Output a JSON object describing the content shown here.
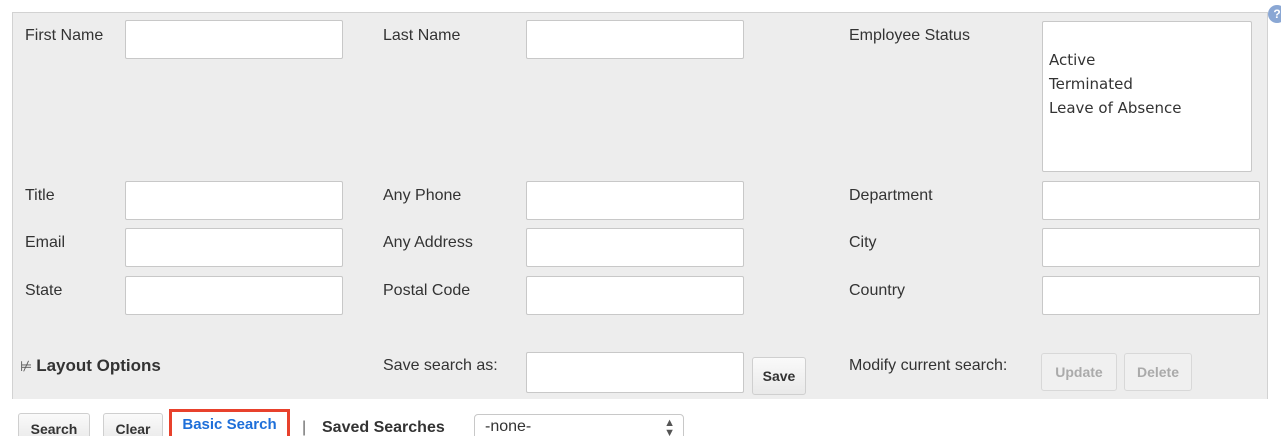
{
  "form": {
    "first_name": {
      "label": "First Name",
      "value": ""
    },
    "last_name": {
      "label": "Last Name",
      "value": ""
    },
    "employee_status": {
      "label": "Employee Status",
      "options": [
        "Active",
        "Terminated",
        "Leave of Absence"
      ]
    },
    "title": {
      "label": "Title",
      "value": ""
    },
    "any_phone": {
      "label": "Any Phone",
      "value": ""
    },
    "department": {
      "label": "Department",
      "value": ""
    },
    "email": {
      "label": "Email",
      "value": ""
    },
    "any_address": {
      "label": "Any Address",
      "value": ""
    },
    "city": {
      "label": "City",
      "value": ""
    },
    "state": {
      "label": "State",
      "value": ""
    },
    "postal_code": {
      "label": "Postal Code",
      "value": ""
    },
    "country": {
      "label": "Country",
      "value": ""
    }
  },
  "layout_options": {
    "label": "Layout Options"
  },
  "save_search": {
    "label": "Save search as:",
    "value": "",
    "button": "Save"
  },
  "modify_search": {
    "label": "Modify current search:",
    "update": "Update",
    "delete": "Delete"
  },
  "actions": {
    "search": "Search",
    "clear": "Clear",
    "basic_search": "Basic Search",
    "separator": "|",
    "saved_searches_label": "Saved Searches",
    "saved_searches_value": "-none-"
  },
  "help_icon": "?",
  "colors": {
    "highlight_border": "#e8412c",
    "link_blue": "#1e6fd9",
    "panel_bg": "#ededed"
  }
}
